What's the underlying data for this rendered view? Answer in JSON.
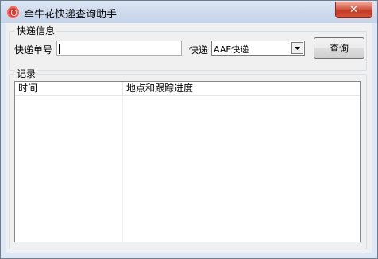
{
  "window": {
    "title": "牵牛花快递查询助手",
    "close_glyph": "✕"
  },
  "query_group": {
    "label": "快递信息",
    "tracking_label": "快递单号",
    "tracking_value": "",
    "courier_label": "快递",
    "courier_selected": "AAE快递",
    "search_button": "查询"
  },
  "records_group": {
    "label": "记录",
    "columns": [
      "时间",
      "地点和跟踪进度"
    ]
  },
  "colors": {
    "close_button": "#c23a22",
    "app_icon": "#e8322a"
  },
  "icons": {
    "app": "app-logo-icon",
    "close": "close-icon",
    "dropdown": "chevron-down-icon"
  }
}
